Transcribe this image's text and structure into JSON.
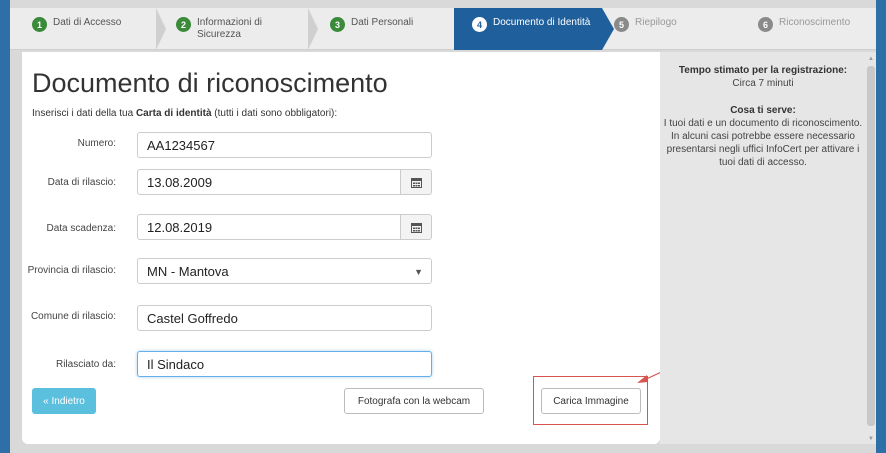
{
  "steps": [
    {
      "num": "1",
      "label": "Dati di Accesso",
      "state": "done"
    },
    {
      "num": "2",
      "label": "Informazioni di Sicurezza",
      "state": "done"
    },
    {
      "num": "3",
      "label": "Dati Personali",
      "state": "done"
    },
    {
      "num": "4",
      "label": "Documento di Identità",
      "state": "active"
    },
    {
      "num": "5",
      "label": "Riepilogo",
      "state": "todo"
    },
    {
      "num": "6",
      "label": "Riconoscimento",
      "state": "todo"
    }
  ],
  "form": {
    "title": "Documento di riconoscimento",
    "intro_pre": "Inserisci i dati della tua ",
    "intro_bold": "Carta di identità",
    "intro_post": " (tutti i dati sono obbligatori):",
    "numero_label": "Numero:",
    "numero_value": "AA1234567",
    "data_rilascio_label": "Data di rilascio:",
    "data_rilascio_value": "13.08.2009",
    "data_scadenza_label": "Data scadenza:",
    "data_scadenza_value": "12.08.2019",
    "provincia_label": "Provincia di rilascio:",
    "provincia_value": "MN - Mantova",
    "comune_label": "Comune di rilascio:",
    "comune_value": "Castel Goffredo",
    "rilasciato_label": "Rilasciato da:",
    "rilasciato_value": "Il Sindaco"
  },
  "buttons": {
    "back": "« Indietro",
    "webcam": "Fotografa con la webcam",
    "upload": "Carica Immagine"
  },
  "sidebar": {
    "time_title": "Tempo stimato per la registrazione:",
    "time_value": "Circa 7 minuti",
    "need_title": "Cosa ti serve:",
    "need_text": "I tuoi dati e un documento di riconoscimento. In alcuni casi potrebbe essere necessario presentarsi negli uffici InfoCert per attivare i tuoi dati di accesso."
  },
  "colors": {
    "active_step": "#1f5f9c",
    "done_badge": "#3a8a3a",
    "back_button": "#5bc0de",
    "highlight": "#d9534f"
  }
}
